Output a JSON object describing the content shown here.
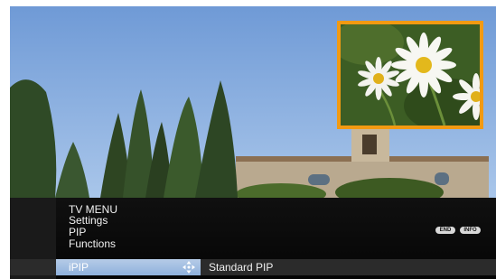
{
  "menu": {
    "path": [
      "TV MENU",
      "Settings",
      "PIP",
      "Functions"
    ],
    "selected_item": "iPIP",
    "selected_value": "Standard PIP"
  },
  "buttons": {
    "end": "END",
    "info": "INFO"
  },
  "icons": {
    "navigation": "dpad-arrows-icon"
  },
  "colors": {
    "pip_border": "#f29a12",
    "highlight": "#a9c3e6",
    "menu_background": "#0a0a0a"
  }
}
